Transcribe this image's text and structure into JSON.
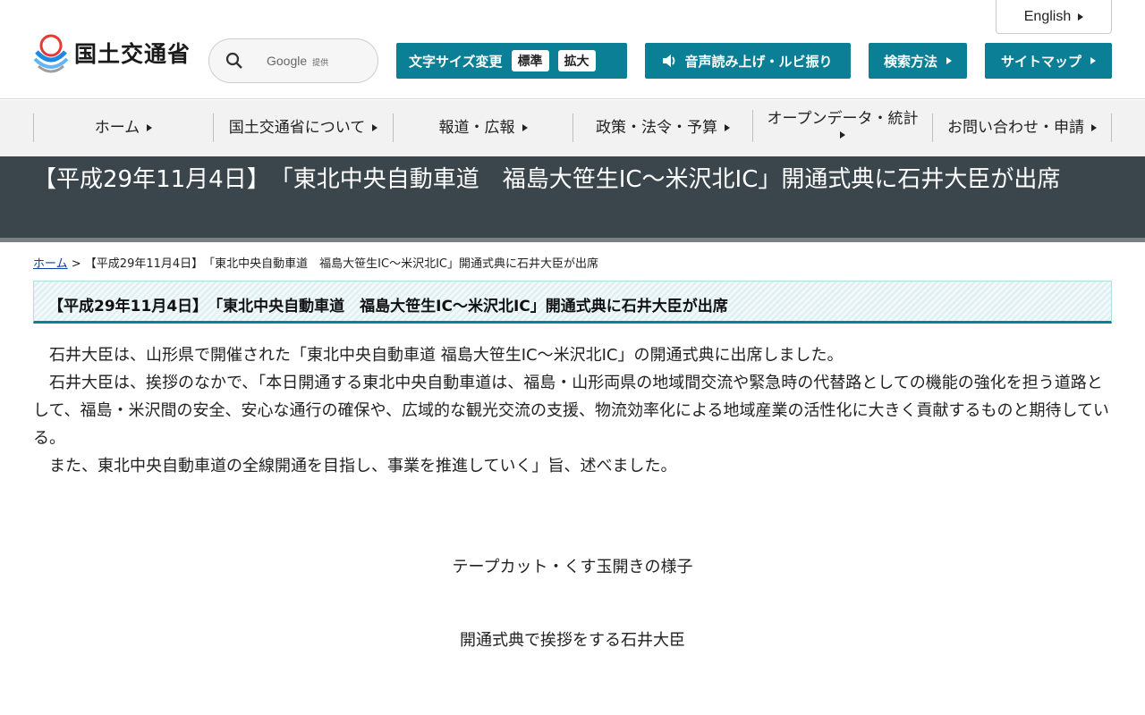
{
  "header": {
    "logo_text": "国土交通省",
    "search": {
      "label": "Google",
      "sub": "提供"
    },
    "english": "English",
    "fontsize": {
      "label": "文字サイズ変更",
      "standard": "標準",
      "large": "拡大"
    },
    "voice": "音声読み上げ・ルビ振り",
    "search_method": "検索方法",
    "sitemap": "サイトマップ"
  },
  "nav": {
    "items": [
      {
        "label": "ホーム"
      },
      {
        "label": "国土交通省について"
      },
      {
        "label": "報道・広報"
      },
      {
        "label": "政策・法令・予算"
      },
      {
        "label": "オープンデータ・統計"
      },
      {
        "label": "お問い合わせ・申請"
      }
    ]
  },
  "page": {
    "title": "【平成29年11月4日】　「東北中央自動車道　福島大笹生IC～米沢北IC」開通式典に石井大臣が出席",
    "breadcrumb_home": "ホーム",
    "breadcrumb_sep": " > ",
    "breadcrumb_current": "【平成29年11月4日】　「東北中央自動車道　福島大笹生IC～米沢北IC」開通式典に石井大臣が出席",
    "subheading": "【平成29年11月4日】　「東北中央自動車道　福島大笹生IC～米沢北IC」開通式典に石井大臣が出席",
    "paragraphs": [
      "石井大臣は、山形県で開催された「東北中央自動車道 福島大笹生IC～米沢北IC」の開通式典に出席しました。",
      "石井大臣は、挨拶のなかで、「本日開通する東北中央自動車道は、福島・山形両県の地域間交流や緊急時の代替路としての機能の強化を担う道路として、福島・米沢間の安全、安心な通行の確保や、広域的な観光交流の支援、物流効率化による地域産業の活性化に大きく貢献するものと期待している。",
      "また、東北中央自動車道の全線開通を目指し、事業を推進していく」旨、述べました。"
    ],
    "caption_1": "テープカット・くす玉開きの様子",
    "caption_2": "開通式典で挨拶をする石井大臣"
  },
  "colors": {
    "accent": "#0a7f95",
    "title_band": "#3a464c",
    "nav_bg": "#f2f2f2"
  }
}
